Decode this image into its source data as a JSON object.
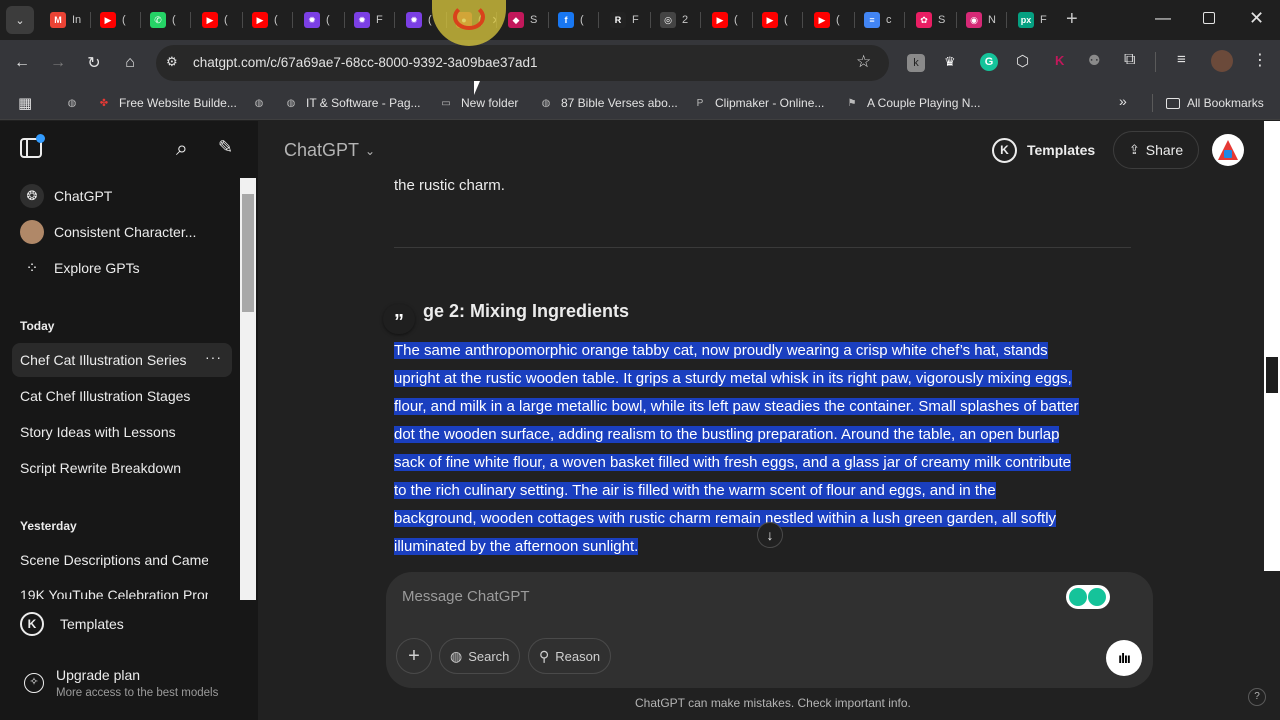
{
  "browser": {
    "tabs": [
      {
        "favicon": "gmail-icon",
        "color": "#ea4335",
        "glyph": "M",
        "title": "In"
      },
      {
        "favicon": "youtube-icon",
        "color": "#ff0000",
        "glyph": "▶",
        "title": "("
      },
      {
        "favicon": "whatsapp-icon",
        "color": "#25d366",
        "glyph": "✆",
        "title": "("
      },
      {
        "favicon": "youtube-icon",
        "color": "#ff0000",
        "glyph": "▶",
        "title": "("
      },
      {
        "favicon": "youtube-icon",
        "color": "#ff0000",
        "glyph": "▶",
        "title": "("
      },
      {
        "favicon": "gear-purple-icon",
        "color": "#7b3fe4",
        "glyph": "✹",
        "title": "("
      },
      {
        "favicon": "gear-purple-icon",
        "color": "#7b3fe4",
        "glyph": "✹",
        "title": "F"
      },
      {
        "favicon": "gear-purple-icon",
        "color": "#7b3fe4",
        "glyph": "✹",
        "title": "("
      },
      {
        "favicon": "active-tab-icon",
        "color": "#c0392b",
        "glyph": "●",
        "title": "("
      },
      {
        "favicon": "diamond-icon",
        "color": "#c2185b",
        "glyph": "◆",
        "title": "S"
      },
      {
        "favicon": "facebook-icon",
        "color": "#1877f2",
        "glyph": "f",
        "title": "("
      },
      {
        "favicon": "r-icon",
        "color": "#222222",
        "glyph": "R",
        "title": "F"
      },
      {
        "favicon": "openai-icon",
        "color": "#444444",
        "glyph": "◎",
        "title": "2"
      },
      {
        "favicon": "youtube-icon",
        "color": "#ff0000",
        "glyph": "▶",
        "title": "("
      },
      {
        "favicon": "youtube-icon",
        "color": "#ff0000",
        "glyph": "▶",
        "title": "("
      },
      {
        "favicon": "youtube-icon",
        "color": "#ff0000",
        "glyph": "▶",
        "title": "("
      },
      {
        "favicon": "docs-icon",
        "color": "#4285f4",
        "glyph": "≡",
        "title": "c"
      },
      {
        "favicon": "image-icon",
        "color": "#e91e63",
        "glyph": "✿",
        "title": "S"
      },
      {
        "favicon": "instagram-icon",
        "color": "#d62976",
        "glyph": "◉",
        "title": "N"
      },
      {
        "favicon": "pexels-icon",
        "color": "#05a081",
        "glyph": "px",
        "title": "F"
      }
    ],
    "url": "chatgpt.com/c/67a69ae7-68cc-8000-9392-3a09bae37ad1",
    "bookmarks": [
      {
        "icon": "globe-icon",
        "label": ""
      },
      {
        "icon": "pinwheel-icon",
        "label": "Free Website Builde..."
      },
      {
        "icon": "globe-icon",
        "label": ""
      },
      {
        "icon": "globe-icon",
        "label": "IT & Software - Pag..."
      },
      {
        "icon": "folder-icon",
        "label": "New folder"
      },
      {
        "icon": "globe-icon",
        "label": "87 Bible Verses abo..."
      },
      {
        "icon": "p-icon",
        "label": "Clipmaker - Online..."
      },
      {
        "icon": "flag-icon",
        "label": "A Couple Playing N..."
      }
    ],
    "all_bookmarks": "All Bookmarks"
  },
  "sidebar": {
    "top_items": [
      {
        "icon": "openai-icon",
        "label": "ChatGPT"
      },
      {
        "icon": "avatar-icon",
        "label": "Consistent Character..."
      },
      {
        "icon": "grid-icon",
        "label": "Explore GPTs"
      }
    ],
    "today_heading": "Today",
    "today": [
      "Chef Cat Illustration Series",
      "Cat Chef Illustration Stages",
      "Story Ideas with Lessons",
      "Script Rewrite Breakdown"
    ],
    "yesterday_heading": "Yesterday",
    "yesterday": [
      "Scene Descriptions and Camer",
      "19K YouTube Celebration Pron"
    ],
    "templates": "Templates",
    "upgrade_title": "Upgrade plan",
    "upgrade_sub": "More access to the best models"
  },
  "header": {
    "model": "ChatGPT",
    "templates": "Templates",
    "share": "Share"
  },
  "conversation": {
    "prev_tail": "the rustic charm.",
    "stage_heading": "ge 2: Mixing Ingredients",
    "lines": [
      "The same anthropomorphic orange tabby cat, now proudly wearing a crisp white chef’s hat, stands",
      "upright at the rustic wooden table. It grips a sturdy metal whisk in its right paw, vigorously mixing eggs,",
      "flour, and milk in a large metallic bowl, while its left paw steadies the container. Small splashes of batter",
      "dot the wooden surface, adding realism to the bustling preparation. Around the table, an open burlap",
      "sack of fine white flour, a woven basket filled with fresh eggs, and a glass jar of creamy milk contribute",
      "to the rich culinary setting. The air is filled with the warm scent of flour and eggs, and in the",
      "background, wooden cottages with rustic charm remain nestled within a lush green garden, all softly",
      "illuminated by the afternoon sunlight."
    ]
  },
  "composer": {
    "placeholder": "Message ChatGPT",
    "search": "Search",
    "reason": "Reason"
  },
  "footer": "ChatGPT can make mistakes. Check important info.",
  "help": "?"
}
